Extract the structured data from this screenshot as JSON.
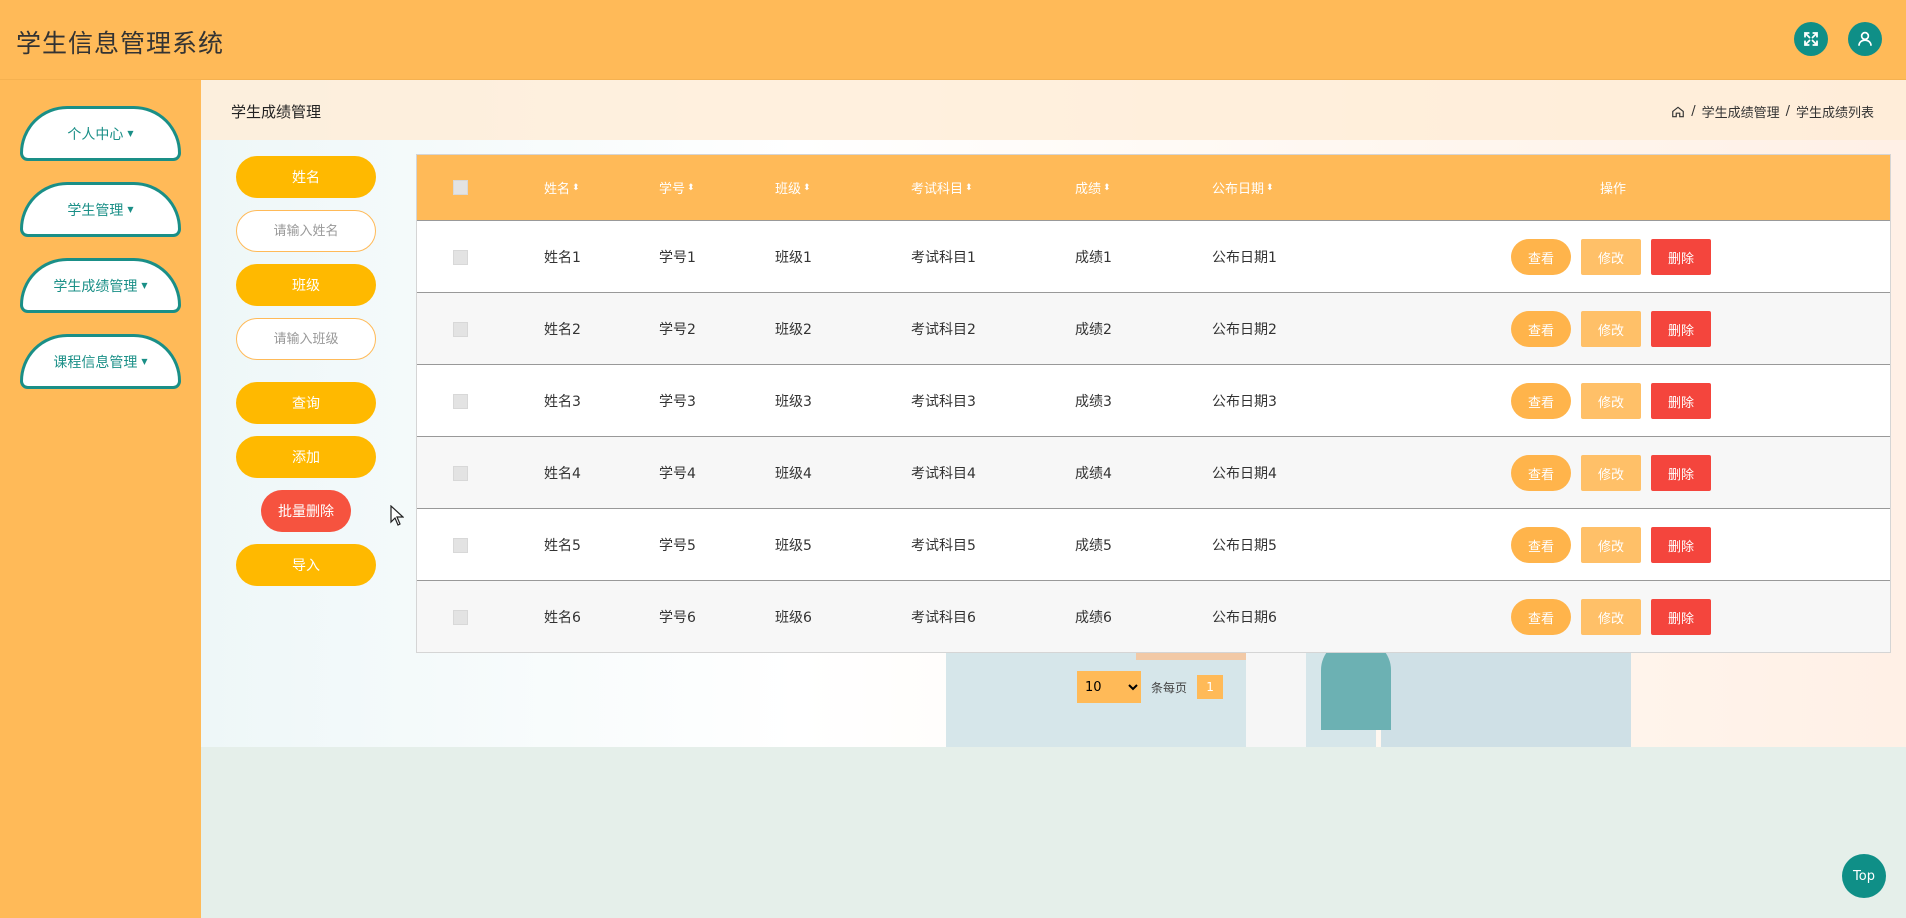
{
  "app": {
    "title": "学生信息管理系统"
  },
  "header": {
    "fullscreen_icon": "expand-icon",
    "user_icon": "user-icon"
  },
  "sidebar": {
    "items": [
      {
        "label": "个人中心"
      },
      {
        "label": "学生管理"
      },
      {
        "label": "学生成绩管理"
      },
      {
        "label": "课程信息管理"
      }
    ]
  },
  "breadcrumb": {
    "page_title": "学生成绩管理",
    "path": [
      "学生成绩管理",
      "学生成绩列表"
    ],
    "separator": "/"
  },
  "filters": {
    "name_label": "姓名",
    "name_placeholder": "请输入姓名",
    "class_label": "班级",
    "class_placeholder": "请输入班级",
    "search": "查询",
    "add": "添加",
    "batch_delete": "批量删除",
    "import": "导入"
  },
  "table": {
    "columns": [
      "姓名",
      "学号",
      "班级",
      "考试科目",
      "成绩",
      "公布日期",
      "操作"
    ],
    "sort_glyph": "⬍",
    "rows": [
      [
        "姓名1",
        "学号1",
        "班级1",
        "考试科目1",
        "成绩1",
        "公布日期1"
      ],
      [
        "姓名2",
        "学号2",
        "班级2",
        "考试科目2",
        "成绩2",
        "公布日期2"
      ],
      [
        "姓名3",
        "学号3",
        "班级3",
        "考试科目3",
        "成绩3",
        "公布日期3"
      ],
      [
        "姓名4",
        "学号4",
        "班级4",
        "考试科目4",
        "成绩4",
        "公布日期4"
      ],
      [
        "姓名5",
        "学号5",
        "班级5",
        "考试科目5",
        "成绩5",
        "公布日期5"
      ],
      [
        "姓名6",
        "学号6",
        "班级6",
        "考试科目6",
        "成绩6",
        "公布日期6"
      ]
    ],
    "actions": {
      "view": "查看",
      "edit": "修改",
      "delete": "删除"
    }
  },
  "pagination": {
    "page_size": "10",
    "page_size_options": [
      "10"
    ],
    "per_page_label": "条每页",
    "current_page": "1"
  },
  "back_to_top": "Top",
  "colors": {
    "primary": "#ffba58",
    "accent": "#0f8f87",
    "button": "#ffb900",
    "danger": "#f4453d"
  }
}
